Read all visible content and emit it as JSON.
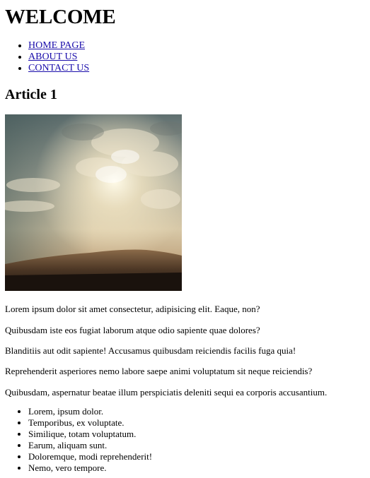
{
  "header": {
    "title": "WELCOME"
  },
  "nav": {
    "items": [
      {
        "label": "HOME PAGE"
      },
      {
        "label": "ABOUT US"
      },
      {
        "label": "CONTACT US"
      }
    ]
  },
  "article": {
    "title": "Article 1",
    "paragraphs": [
      "Lorem ipsum dolor sit amet consectetur, adipisicing elit. Eaque, non?",
      "Quibusdam iste eos fugiat laborum atque odio sapiente quae dolores?",
      "Blanditiis aut odit sapiente! Accusamus quibusdam reiciendis facilis fuga quia!",
      "Reprehenderit asperiores nemo labore saepe animi voluptatum sit neque reiciendis?",
      "Quibusdam, aspernatur beatae illum perspiciatis deleniti sequi ea corporis accusantium."
    ],
    "list": [
      "Lorem, ipsum dolor.",
      "Temporibus, ex voluptate.",
      "Similique, totam voluptatum.",
      "Earum, aliquam sunt.",
      "Doloremque, modi reprehenderit!",
      "Nemo, vero tempore."
    ]
  }
}
